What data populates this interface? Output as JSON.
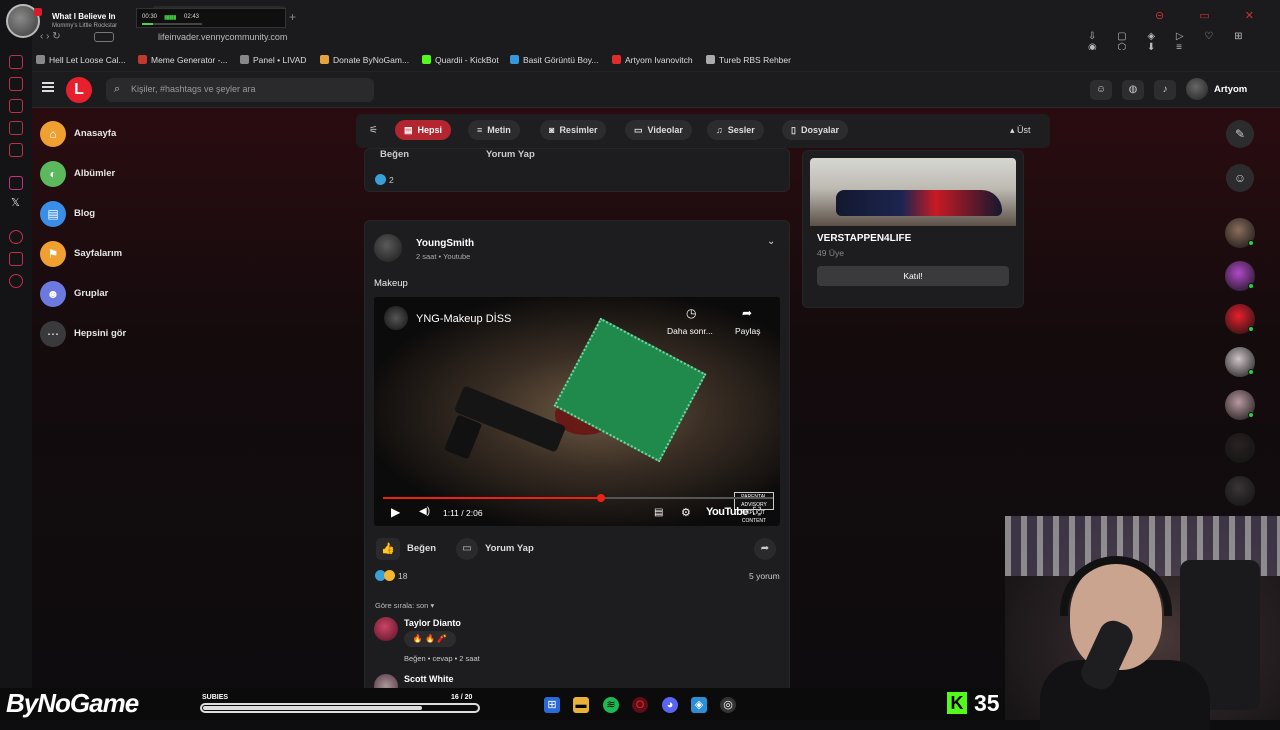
{
  "media": {
    "title": "What I Believe In",
    "artist": "Mommy's Little Rockstar",
    "time_current": "00:30",
    "time_total": "02:43",
    "progress": 0.18,
    "bars": "▮▮▮▮▮"
  },
  "browser": {
    "url": "lifeinvader.vennycommunity.com",
    "new_tab": "+",
    "window_controls": "⊝ ▭ ✕",
    "ext_icons": "⇩ ▢ ◈ ▷ ♡ ⊞ ◉ ⬡ ⬇ ≡"
  },
  "bookmarks": [
    {
      "label": "Hell Let Loose Cal...",
      "color": "#888888"
    },
    {
      "label": "Meme Generator -...",
      "color": "#c0392b"
    },
    {
      "label": "Panel • LIVAD",
      "color": "#888888"
    },
    {
      "label": "Donate ByNoGam...",
      "color": "#e6a23c"
    },
    {
      "label": "Quardii - KickBot",
      "color": "#53fc18"
    },
    {
      "label": "Basit Görüntü Boy...",
      "color": "#3498db"
    },
    {
      "label": "Artyom Ivanovitch",
      "color": "#e02b2b"
    },
    {
      "label": "Tureb RBS Rehber",
      "color": "#aaaaaa"
    }
  ],
  "header": {
    "logo": "L",
    "search_placeholder": "Kişiler, #hashtags ve şeyler ara",
    "user_name": "Artyom",
    "icons": [
      "friends-icon",
      "messages-icon",
      "notifications-icon"
    ]
  },
  "nav": [
    {
      "label": "Anasayfa",
      "color": "#f0a030",
      "glyph": "⌂"
    },
    {
      "label": "Albümler",
      "color": "#5cb85c",
      "glyph": "◐"
    },
    {
      "label": "Blog",
      "color": "#3a8ee6",
      "glyph": "▤"
    },
    {
      "label": "Sayfalarım",
      "color": "#f0a030",
      "glyph": "⚑"
    },
    {
      "label": "Gruplar",
      "color": "#6c7ae0",
      "glyph": "☻"
    },
    {
      "label": "Hepsini gör",
      "color": "#3a3a3c",
      "glyph": "⋯"
    }
  ],
  "filters": {
    "items": [
      {
        "label": "Hepsi",
        "glyph": "▤",
        "active": true
      },
      {
        "label": "Metin",
        "glyph": "≡",
        "active": false
      },
      {
        "label": "Resimler",
        "glyph": "◙",
        "active": false
      },
      {
        "label": "Videolar",
        "glyph": "▭",
        "active": false
      },
      {
        "label": "Sesler",
        "glyph": "♫",
        "active": false
      },
      {
        "label": "Dosyalar",
        "glyph": "▯",
        "active": false
      }
    ],
    "top_label": "▴ Üst"
  },
  "prev_post": {
    "like_label": "Beğen",
    "comment_label": "Yorum Yap",
    "reaction_count": "2"
  },
  "post": {
    "author": "YoungSmith",
    "meta": "2 saat • Youtube",
    "text": "Makeup",
    "video": {
      "title": "YNG-Makeup DİSS",
      "later_label": "Daha sonr...",
      "share_label": "Paylaş",
      "time": "1:11 / 2:06",
      "progress": 0.56,
      "brand": "YouTube",
      "advisory": "PARENTAL ADVISORY EXPLICIT CONTENT"
    },
    "like_label": "Beğen",
    "comment_label": "Yorum Yap",
    "reaction_count": "18",
    "comment_count": "5 yorum",
    "sort_label": "Göre sırala: son ▾"
  },
  "comments": [
    {
      "name": "Taylor Dianto",
      "body": "🔥 🔥 🧨",
      "actions": "Beğen • cevap • 2 saat"
    },
    {
      "name": "Scott White",
      "body": "",
      "actions": ""
    }
  ],
  "group": {
    "name": "VERSTAPPEN4LIFE",
    "members": "49 Üye",
    "join_label": "Katıl!"
  },
  "rail": {
    "avatars": [
      {
        "color": "#8a6d5c",
        "online": true
      },
      {
        "color": "#b04ac8",
        "online": true
      },
      {
        "color": "#e8202e",
        "online": true
      },
      {
        "color": "#cfc4c8",
        "online": true
      },
      {
        "color": "#b89aa0",
        "online": true
      },
      {
        "color": "#2a2222",
        "online": false
      },
      {
        "color": "#3a3436",
        "online": false
      }
    ]
  },
  "stream": {
    "logo": "ByNoGame",
    "subs_label": "SUBIES",
    "subs_count": "16 / 20",
    "subs_progress": 0.8,
    "kick_count": "35"
  }
}
